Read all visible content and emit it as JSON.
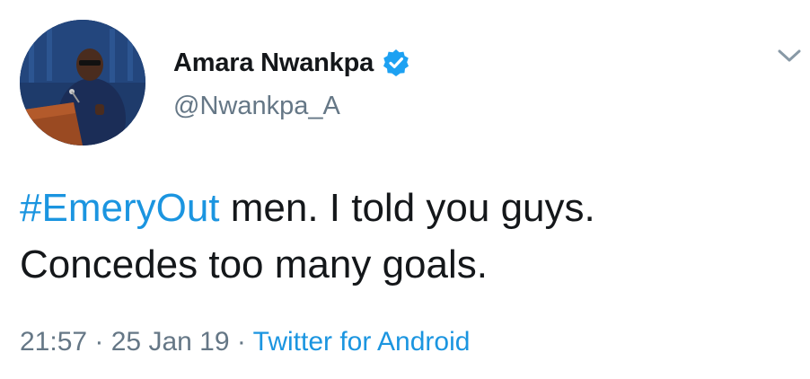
{
  "author": {
    "display_name": "Amara Nwankpa",
    "handle": "@Nwankpa_A",
    "verified": true,
    "avatar_icon": "profile-photo-speaker-at-podium"
  },
  "tweet": {
    "hashtag": "#EmeryOut",
    "text_line1_rest": " men. I told you guys.",
    "text_line2": "Concedes too many goals."
  },
  "meta": {
    "time": "21:57",
    "separator": " · ",
    "date": "25 Jan 19",
    "source": "Twitter for Android"
  },
  "colors": {
    "link": "#1b95e0",
    "text": "#14171a",
    "secondary": "#657786",
    "verified": "#1da1f2"
  },
  "icons": {
    "verified": "verified-badge-icon",
    "menu": "chevron-down-icon"
  }
}
